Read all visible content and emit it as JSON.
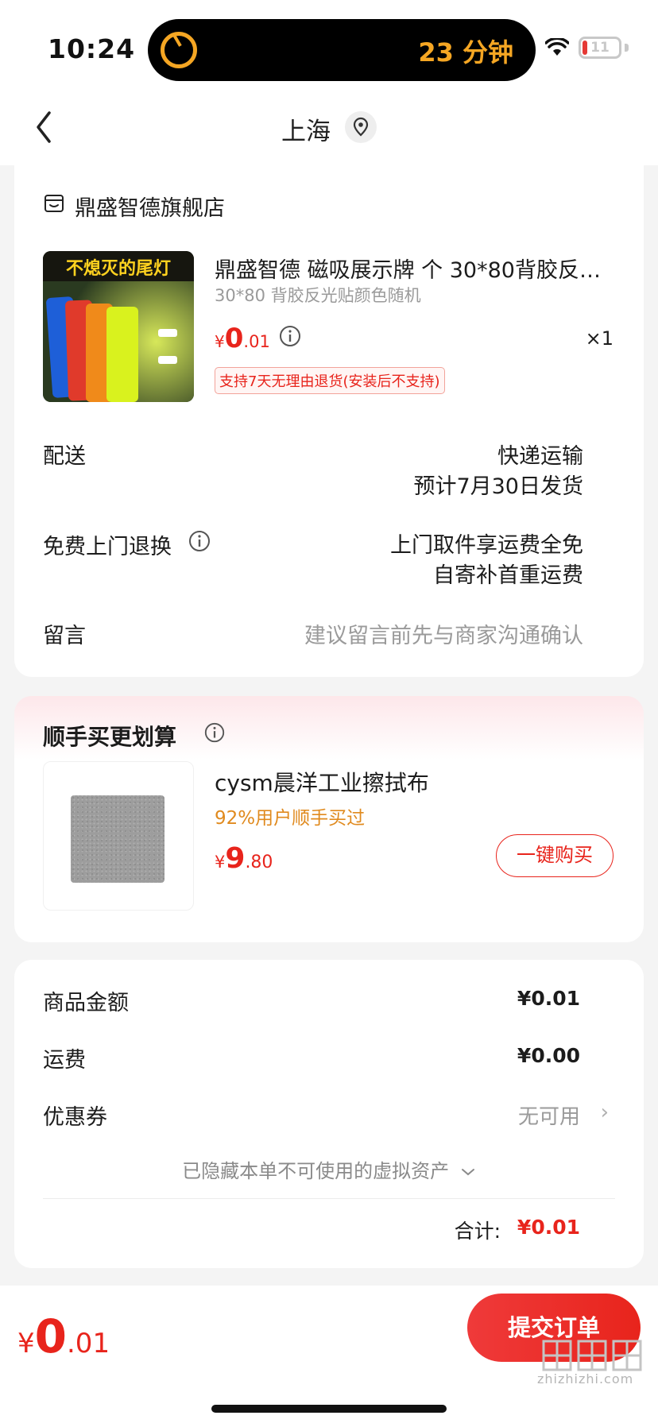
{
  "status_bar": {
    "time": "10:24",
    "live_activity": "23 分钟",
    "battery": "11"
  },
  "nav": {
    "title": "上海",
    "icons": [
      "back-chevron-icon",
      "location-pin-icon"
    ]
  },
  "order": {
    "store_name": "鼎盛智德旗舰店",
    "product": {
      "image_caption": "不熄灭的尾灯",
      "title": "鼎盛智德 磁吸展示牌 个 30*80背胶反…",
      "spec": "30*80 背胶反光贴颜色随机",
      "price_currency": "¥",
      "price_int": "0",
      "price_dec": ".01",
      "qty": "×1",
      "return_policy": "支持7天无理由退货(安装后不支持)"
    },
    "rows": {
      "delivery_label": "配送",
      "delivery_value1": "快递运输",
      "delivery_value2": "预计7月30日发货",
      "returns_label": "免费上门退换",
      "returns_value1": "上门取件享运费全免",
      "returns_value2": "自寄补首重运费",
      "message_label": "留言",
      "message_placeholder": "建议留言前先与商家沟通确认"
    }
  },
  "upsell": {
    "title": "顺手买更划算",
    "item_name": "cysm晨洋工业擦拭布",
    "item_sub": "92%用户顺手买过",
    "price_currency": "¥",
    "price_int": "9",
    "price_dec": ".80",
    "buy_label": "一键购买"
  },
  "summary": {
    "goods_label": "商品金额",
    "goods_value": "¥0.01",
    "shipping_label": "运费",
    "shipping_value": "¥0.00",
    "coupon_label": "优惠券",
    "coupon_value": "无可用",
    "hidden_assets": "已隐藏本单不可使用的虚拟资产",
    "total_label": "合计:",
    "total_value": "¥0.01"
  },
  "bottom": {
    "price_currency": "¥",
    "price_int": "0",
    "price_dec": ".01",
    "submit_label": "提交订单",
    "watermark": "zhizhizhi.com"
  },
  "colors": {
    "accent": "#e8241c",
    "orange": "#e08a1e",
    "muted": "#9a9a9a"
  }
}
